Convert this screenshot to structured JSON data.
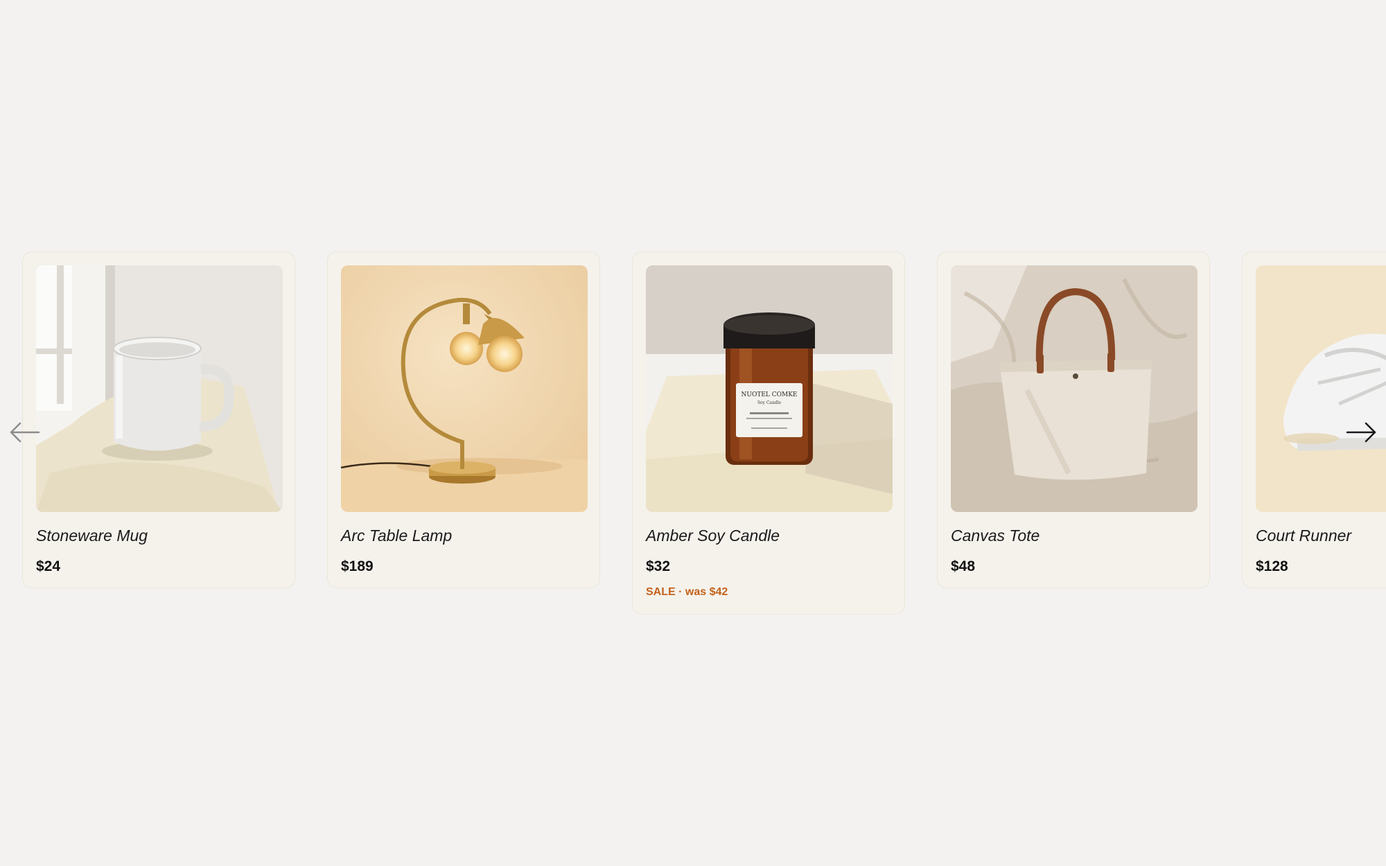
{
  "products": [
    {
      "title": "Stoneware Mug",
      "price": "$24",
      "image": "stoneware-mug-photo"
    },
    {
      "title": "Arc Table Lamp",
      "price": "$189",
      "image": "arc-table-lamp-photo"
    },
    {
      "title": "Amber Soy Candle",
      "price": "$32",
      "sale_note": "SALE · was $42",
      "image": "amber-soy-candle-photo",
      "label_text": [
        "NUOTEL COMKE",
        "Soy Candle"
      ]
    },
    {
      "title": "Canvas Tote",
      "price": "$48",
      "image": "canvas-tote-photo"
    },
    {
      "title": "Court Runner",
      "price": "$128",
      "image": "court-runner-photo"
    }
  ],
  "navigation": {
    "prev_icon": "arrow-left-icon",
    "next_icon": "arrow-right-icon"
  },
  "colors": {
    "page_background": "#f3f2f1",
    "card_background": "#f5f2ec",
    "sale_accent": "#c4621b"
  }
}
